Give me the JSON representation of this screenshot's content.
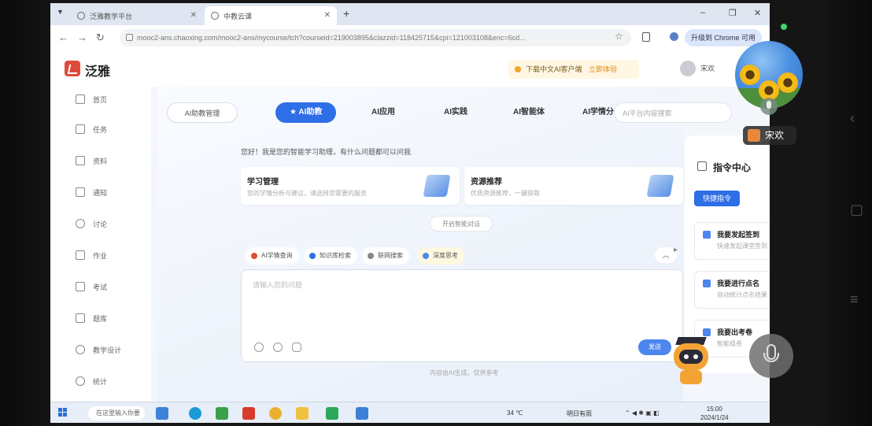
{
  "browser": {
    "tabs": [
      {
        "title": "泛雅教学平台"
      },
      {
        "title": "中教云课"
      }
    ],
    "new_tab": "+",
    "window_controls": {
      "minimize": "–",
      "maximize": "❐",
      "close": "✕"
    },
    "url": "mooc2-ans.chaoxing.com/mooc2-ans/mycourse/tch?courseid=219003895&clazzid=118425715&cpi=121003108&enc=6cd...",
    "chrome_pill": "升级到 Chrome 可用"
  },
  "app": {
    "brand": "泛雅",
    "notice_text": "下载中文AI客户端",
    "notice_link": "立即体验",
    "user_name": "宋欢"
  },
  "sidebar": {
    "items": [
      {
        "label": "首页"
      },
      {
        "label": "任务"
      },
      {
        "label": "资料"
      },
      {
        "label": "通知"
      },
      {
        "label": "讨论"
      },
      {
        "label": "作业"
      },
      {
        "label": "考试"
      },
      {
        "label": "题库"
      },
      {
        "label": "教学设计"
      },
      {
        "label": "统计"
      }
    ]
  },
  "main": {
    "ai_hub": "AI助教管理",
    "tabs": [
      {
        "label": "AI助教",
        "active": true
      },
      {
        "label": "AI应用"
      },
      {
        "label": "AI实践"
      },
      {
        "label": "AI智能体"
      },
      {
        "label": "AI学情分"
      }
    ],
    "search_placeholder": "AI平台内容搜索",
    "greeting": "您好！我是您的智能学习助理，有什么问题都可以问我",
    "cards": [
      {
        "title": "学习管理",
        "desc": "您的学情分析与建议，请选择您需要的服务"
      },
      {
        "title": "资源推荐",
        "desc": "优质资源推荐，一键获取"
      }
    ],
    "try_button": "开启智能对话",
    "chips": [
      {
        "label": "AI学情查询",
        "color": "#e04a3a"
      },
      {
        "label": "知识库检索",
        "color": "#2e6ee6"
      },
      {
        "label": "联网搜索",
        "color": "#888888"
      },
      {
        "label": "深度思考",
        "color": "#4d86ee",
        "selected": true
      }
    ],
    "collapse_label": "︿",
    "input_placeholder": "请输入您的问题",
    "send_label": "发送",
    "disclaimer": "内容由AI生成，仅供参考"
  },
  "right_panel": {
    "title": "指令中心",
    "quick_button": "快捷指令",
    "items": [
      {
        "title": "我要发起签到",
        "desc": "快速发起课堂签到"
      },
      {
        "title": "我要进行点名",
        "desc": "自动统计点名结果"
      },
      {
        "title": "我要出考卷",
        "desc": "智能组卷"
      }
    ]
  },
  "taskbar": {
    "search_text": "在这里输入你要搜索的内容",
    "weather": "34 ℃",
    "input_method": "明日有雨",
    "time": "15:00",
    "date": "2024/1/24"
  },
  "overlay": {
    "caller_name": "宋欢"
  },
  "colors": {
    "accent": "#2e6ee6",
    "brand": "#e04a3a",
    "notice_bg": "#fff7e2"
  }
}
